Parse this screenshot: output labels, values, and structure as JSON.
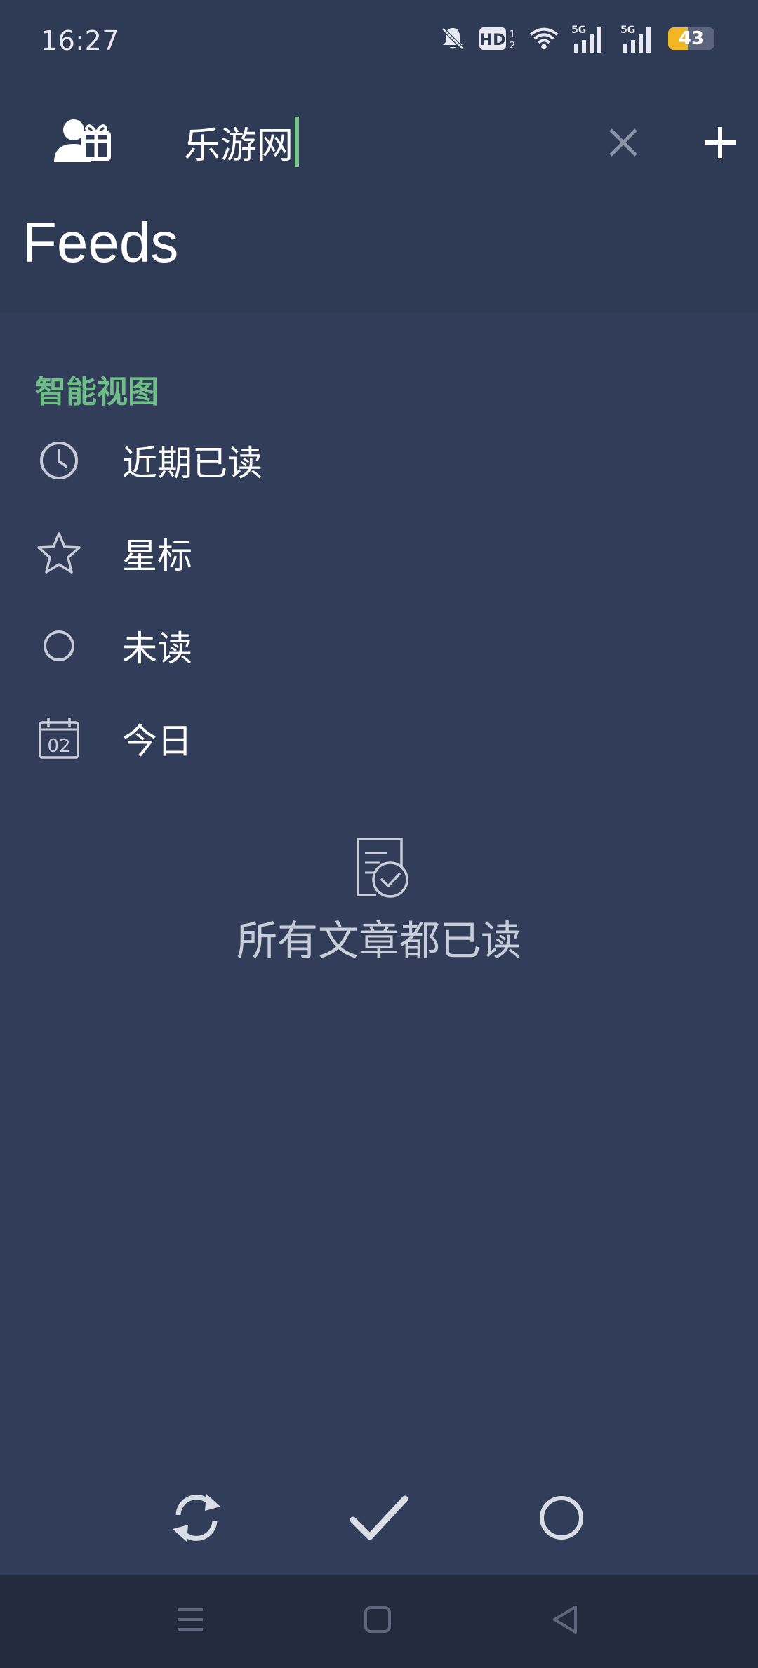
{
  "status_bar": {
    "time": "16:27",
    "hd_label": "HD",
    "hd_sub": "1\n2",
    "signal1_label": "5G",
    "signal2_label": "5G",
    "battery_level": "43",
    "battery_fraction": 0.43,
    "icons": [
      "bell-off-icon",
      "hd-icon",
      "wifi-icon",
      "signal-icon",
      "signal-icon",
      "battery-icon"
    ]
  },
  "toolbar": {
    "account_icon": "user-gift-icon",
    "search_value": "乐游网",
    "clear_icon": "close-icon",
    "add_icon": "plus-icon"
  },
  "page_title": "Feeds",
  "smart_views": {
    "title": "智能视图",
    "items": [
      {
        "label": "近期已读",
        "icon": "clock-icon"
      },
      {
        "label": "星标",
        "icon": "star-icon"
      },
      {
        "label": "未读",
        "icon": "circle-icon"
      },
      {
        "label": "今日",
        "icon": "calendar-icon",
        "icon_text": "02"
      }
    ]
  },
  "empty_state": {
    "icon": "document-check-icon",
    "text": "所有文章都已读"
  },
  "action_bar": {
    "buttons": [
      {
        "name": "refresh-button",
        "icon": "refresh-icon"
      },
      {
        "name": "mark-all-read-button",
        "icon": "check-icon"
      },
      {
        "name": "unread-filter-button",
        "icon": "circle-icon"
      }
    ]
  },
  "nav_bar": {
    "buttons": [
      "menu-icon",
      "home-icon",
      "back-icon"
    ]
  },
  "colors": {
    "background": "#323e59",
    "header": "#2f3b54",
    "accent": "#6ebf86",
    "caret": "#76c58d",
    "navbar": "#242b3e",
    "battery": "#f3b623"
  }
}
